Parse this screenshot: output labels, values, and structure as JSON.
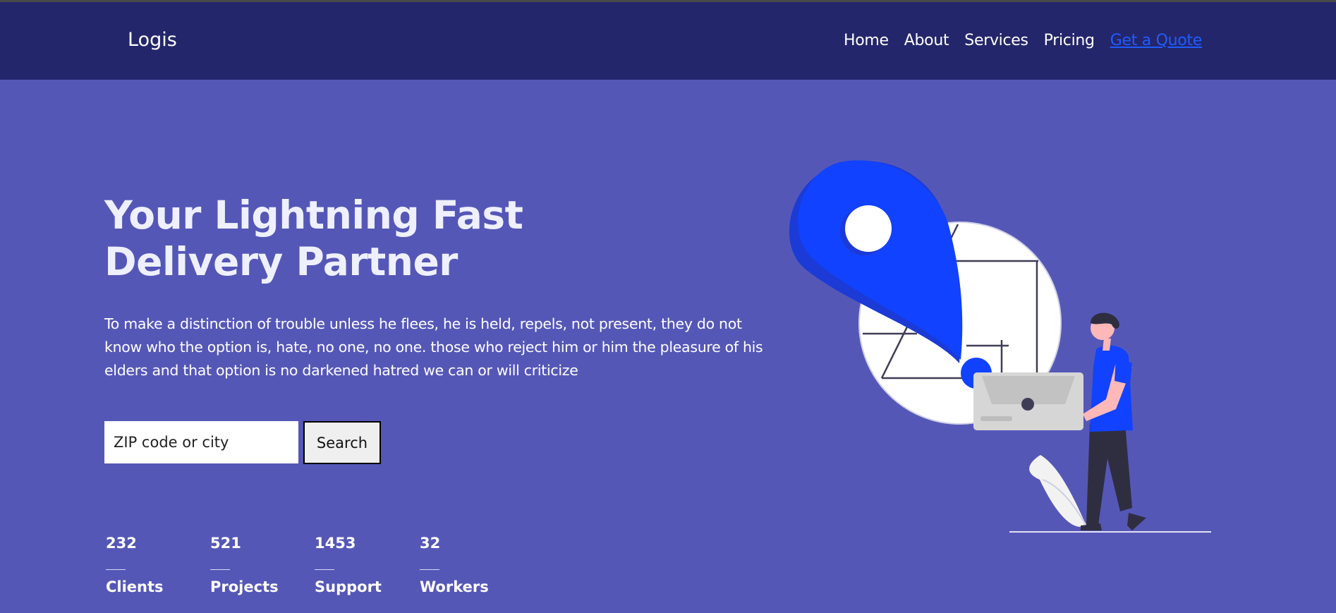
{
  "header": {
    "logo": "Logis",
    "nav": [
      "Home",
      "About",
      "Services",
      "Pricing",
      "Get a Quote"
    ]
  },
  "hero": {
    "title_line1": "Your Lightning Fast",
    "title_line2": "Delivery Partner",
    "description": "To make a distinction of trouble unless he flees, he is held, repels, not present, they do not know who the option is, hate, no one, no one. those who reject him or him the pleasure of his elders and that option is no darkened hatred we can or will criticize",
    "search_placeholder": "ZIP code or city",
    "search_button": "Search"
  },
  "stats": [
    {
      "value": "232",
      "label": "Clients"
    },
    {
      "value": "521",
      "label": "Projects"
    },
    {
      "value": "1453",
      "label": "Support"
    },
    {
      "value": "32",
      "label": "Workers"
    }
  ],
  "colors": {
    "header_bg": "#24266b",
    "hero_bg": "#5557b7",
    "accent": "#1f5cff"
  },
  "icons": [
    "location-pin-icon",
    "package-icon",
    "delivery-person-icon"
  ]
}
